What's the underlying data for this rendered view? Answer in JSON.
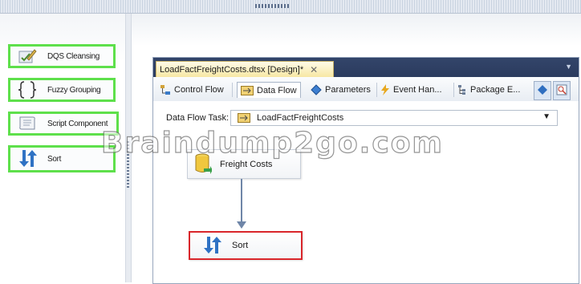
{
  "toolbox": {
    "items": [
      {
        "label": "DQS Cleansing",
        "icon": "pencil-check-icon"
      },
      {
        "label": "Fuzzy Grouping",
        "icon": "braces-icon"
      },
      {
        "label": "Script Component",
        "icon": "script-icon"
      },
      {
        "label": "Sort",
        "icon": "sort-arrows-icon"
      }
    ]
  },
  "designer": {
    "doc_tab": "LoadFactFreightCosts.dtsx [Design]*",
    "doc_close": "✕",
    "doc_menu": "▼",
    "tabs": [
      "Control Flow",
      "Data Flow",
      "Parameters",
      "Event Han...",
      "Package E..."
    ],
    "active_tab": "Data Flow",
    "task_label": "Data Flow Task:",
    "task_value": "LoadFactFreightCosts",
    "components": [
      "Freight Costs",
      "Sort"
    ]
  },
  "watermark": "Braindump2go.com",
  "colors": {
    "highlight_green": "#5ee04b",
    "selection_red": "#d9262b",
    "doc_strip": "#2b3b5e",
    "doc_tab": "#f7e7a4"
  }
}
